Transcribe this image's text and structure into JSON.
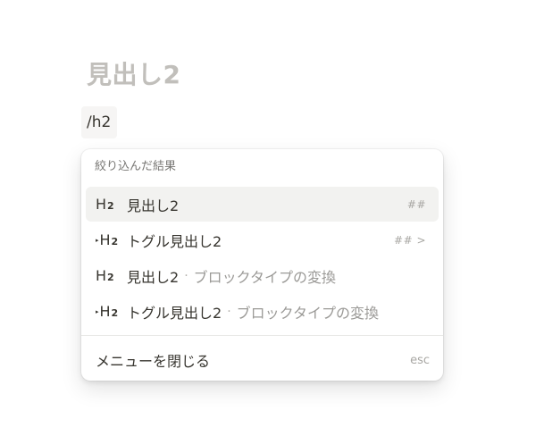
{
  "editor": {
    "heading_placeholder": "見出し2",
    "slash_query": "/h2"
  },
  "menu": {
    "section_title": "絞り込んだ結果",
    "items": [
      {
        "icon": "heading-2-icon",
        "icon_text": "H",
        "icon_sub": "2",
        "label": "見出し2",
        "separator": "",
        "sublabel": "",
        "shortcut": "##",
        "selected": true
      },
      {
        "icon": "toggle-heading-2-icon",
        "icon_triangle": "▸",
        "icon_text": "H",
        "icon_sub": "2",
        "label": "トグル見出し2",
        "separator": "",
        "sublabel": "",
        "shortcut": "## >",
        "selected": false
      },
      {
        "icon": "heading-2-icon",
        "icon_text": "H",
        "icon_sub": "2",
        "label": "見出し2",
        "separator": "·",
        "sublabel": "ブロックタイプの変換",
        "shortcut": "",
        "selected": false
      },
      {
        "icon": "toggle-heading-2-icon",
        "icon_triangle": "▸",
        "icon_text": "H",
        "icon_sub": "2",
        "label": "トグル見出し2",
        "separator": "·",
        "sublabel": "ブロックタイプの変換",
        "shortcut": "",
        "selected": false
      }
    ],
    "close_label": "メニューを閉じる",
    "close_shortcut": "esc"
  },
  "colors": {
    "text": "#37352f",
    "muted": "#9b9a97",
    "placeholder": "#c1bfbb",
    "selected_bg": "#f2f2f0",
    "chip_bg": "#f6f5f4"
  }
}
